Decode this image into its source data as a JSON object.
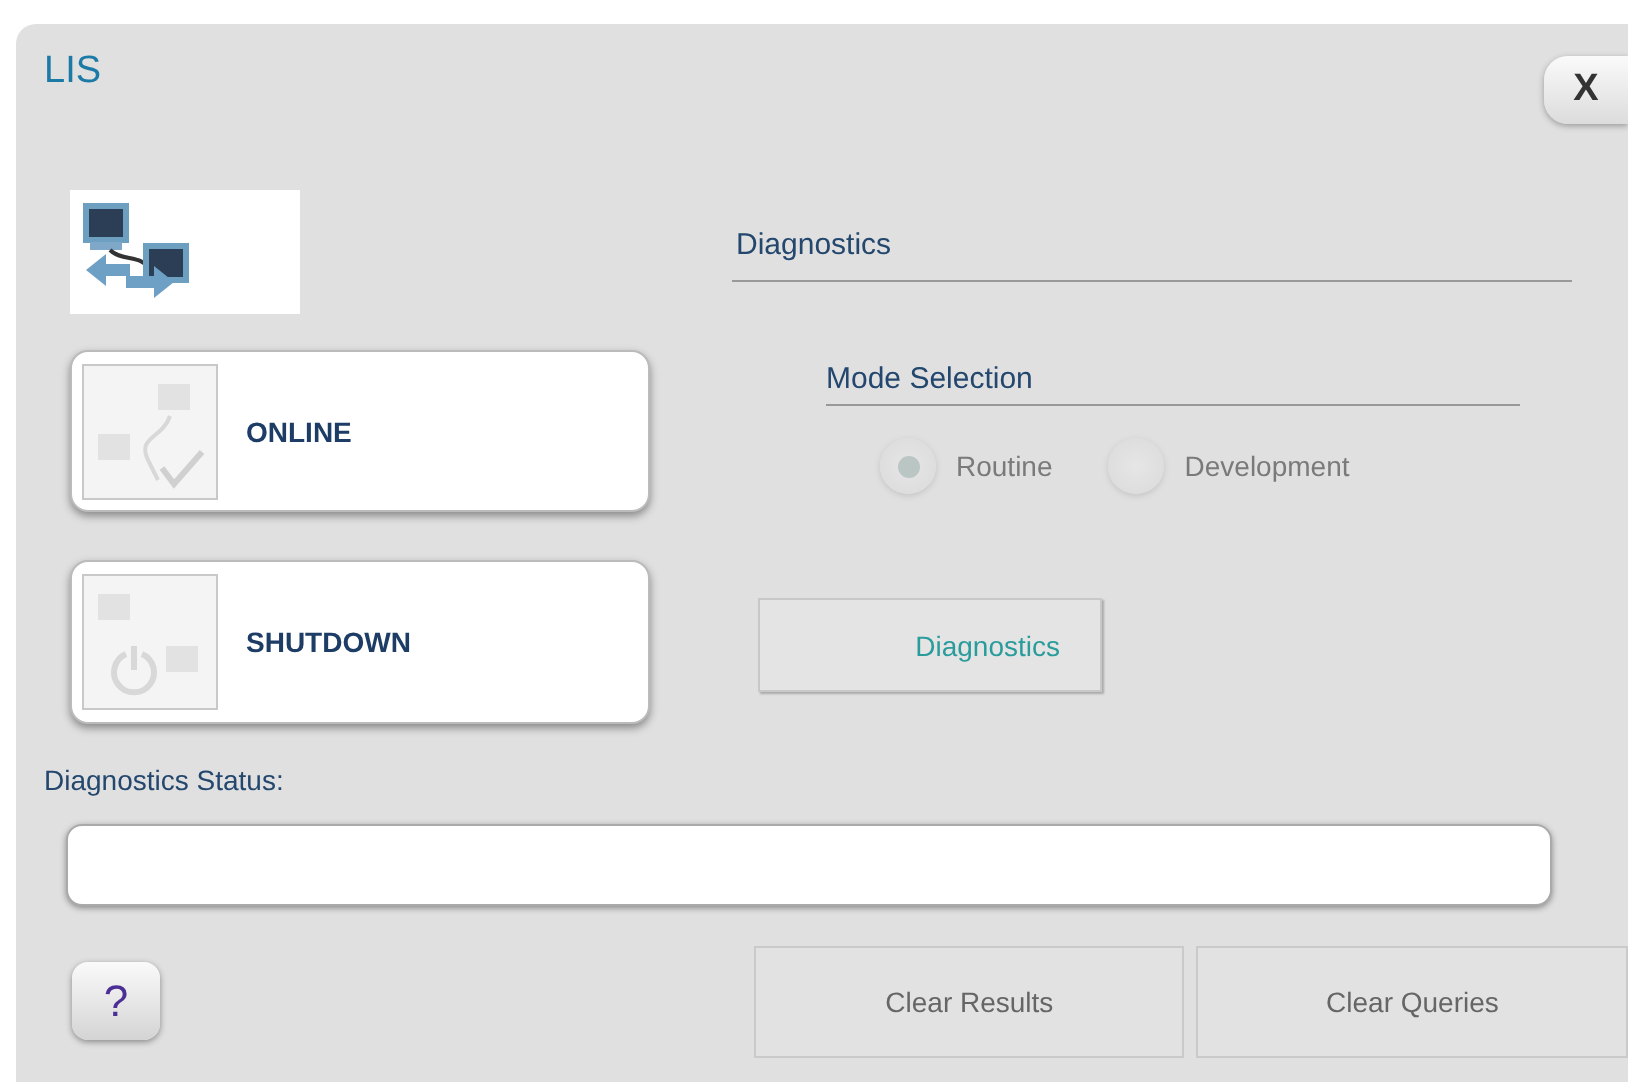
{
  "window": {
    "title": "LIS",
    "close": "X"
  },
  "actions": [
    {
      "kind": "online",
      "label": "ONLINE"
    },
    {
      "kind": "shutdown",
      "label": "SHUTDOWN"
    }
  ],
  "diagnostics": {
    "heading": "Diagnostics",
    "mode_heading": "Mode Selection",
    "disabled": true,
    "modes": [
      {
        "label": "Routine",
        "selected": true
      },
      {
        "label": "Development",
        "selected": false
      }
    ],
    "button": "Diagnostics"
  },
  "status": {
    "label": "Diagnostics Status:"
  },
  "footer": {
    "help": "?",
    "buttons": [
      "Clear Results",
      "Clear Queries"
    ]
  }
}
